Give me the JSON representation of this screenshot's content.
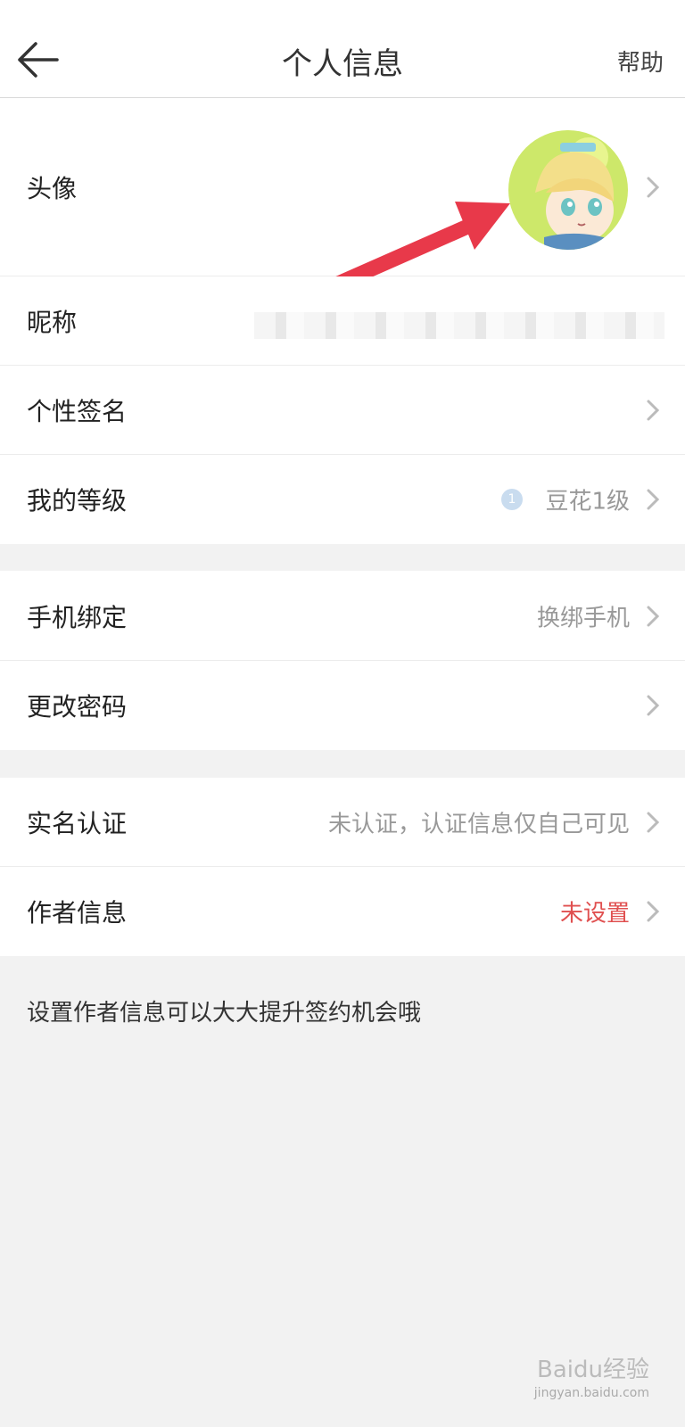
{
  "header": {
    "title": "个人信息",
    "help_label": "帮助"
  },
  "rows": {
    "avatar": {
      "label": "头像"
    },
    "nickname": {
      "label": "昵称"
    },
    "signature": {
      "label": "个性签名"
    },
    "level": {
      "label": "我的等级",
      "value": "豆花1级",
      "badge": "1"
    },
    "phone": {
      "label": "手机绑定",
      "value": "换绑手机"
    },
    "password": {
      "label": "更改密码"
    },
    "realname": {
      "label": "实名认证",
      "value": "未认证，认证信息仅自己可见"
    },
    "author": {
      "label": "作者信息",
      "value": "未设置"
    }
  },
  "footnote": "设置作者信息可以大大提升签约机会哦",
  "watermark": {
    "brand": "Baidu经验",
    "url": "jingyan.baidu.com"
  },
  "colors": {
    "accent_red": "#e05050",
    "arrow": "#e8394a",
    "avatar_bg": "#cde86a"
  }
}
